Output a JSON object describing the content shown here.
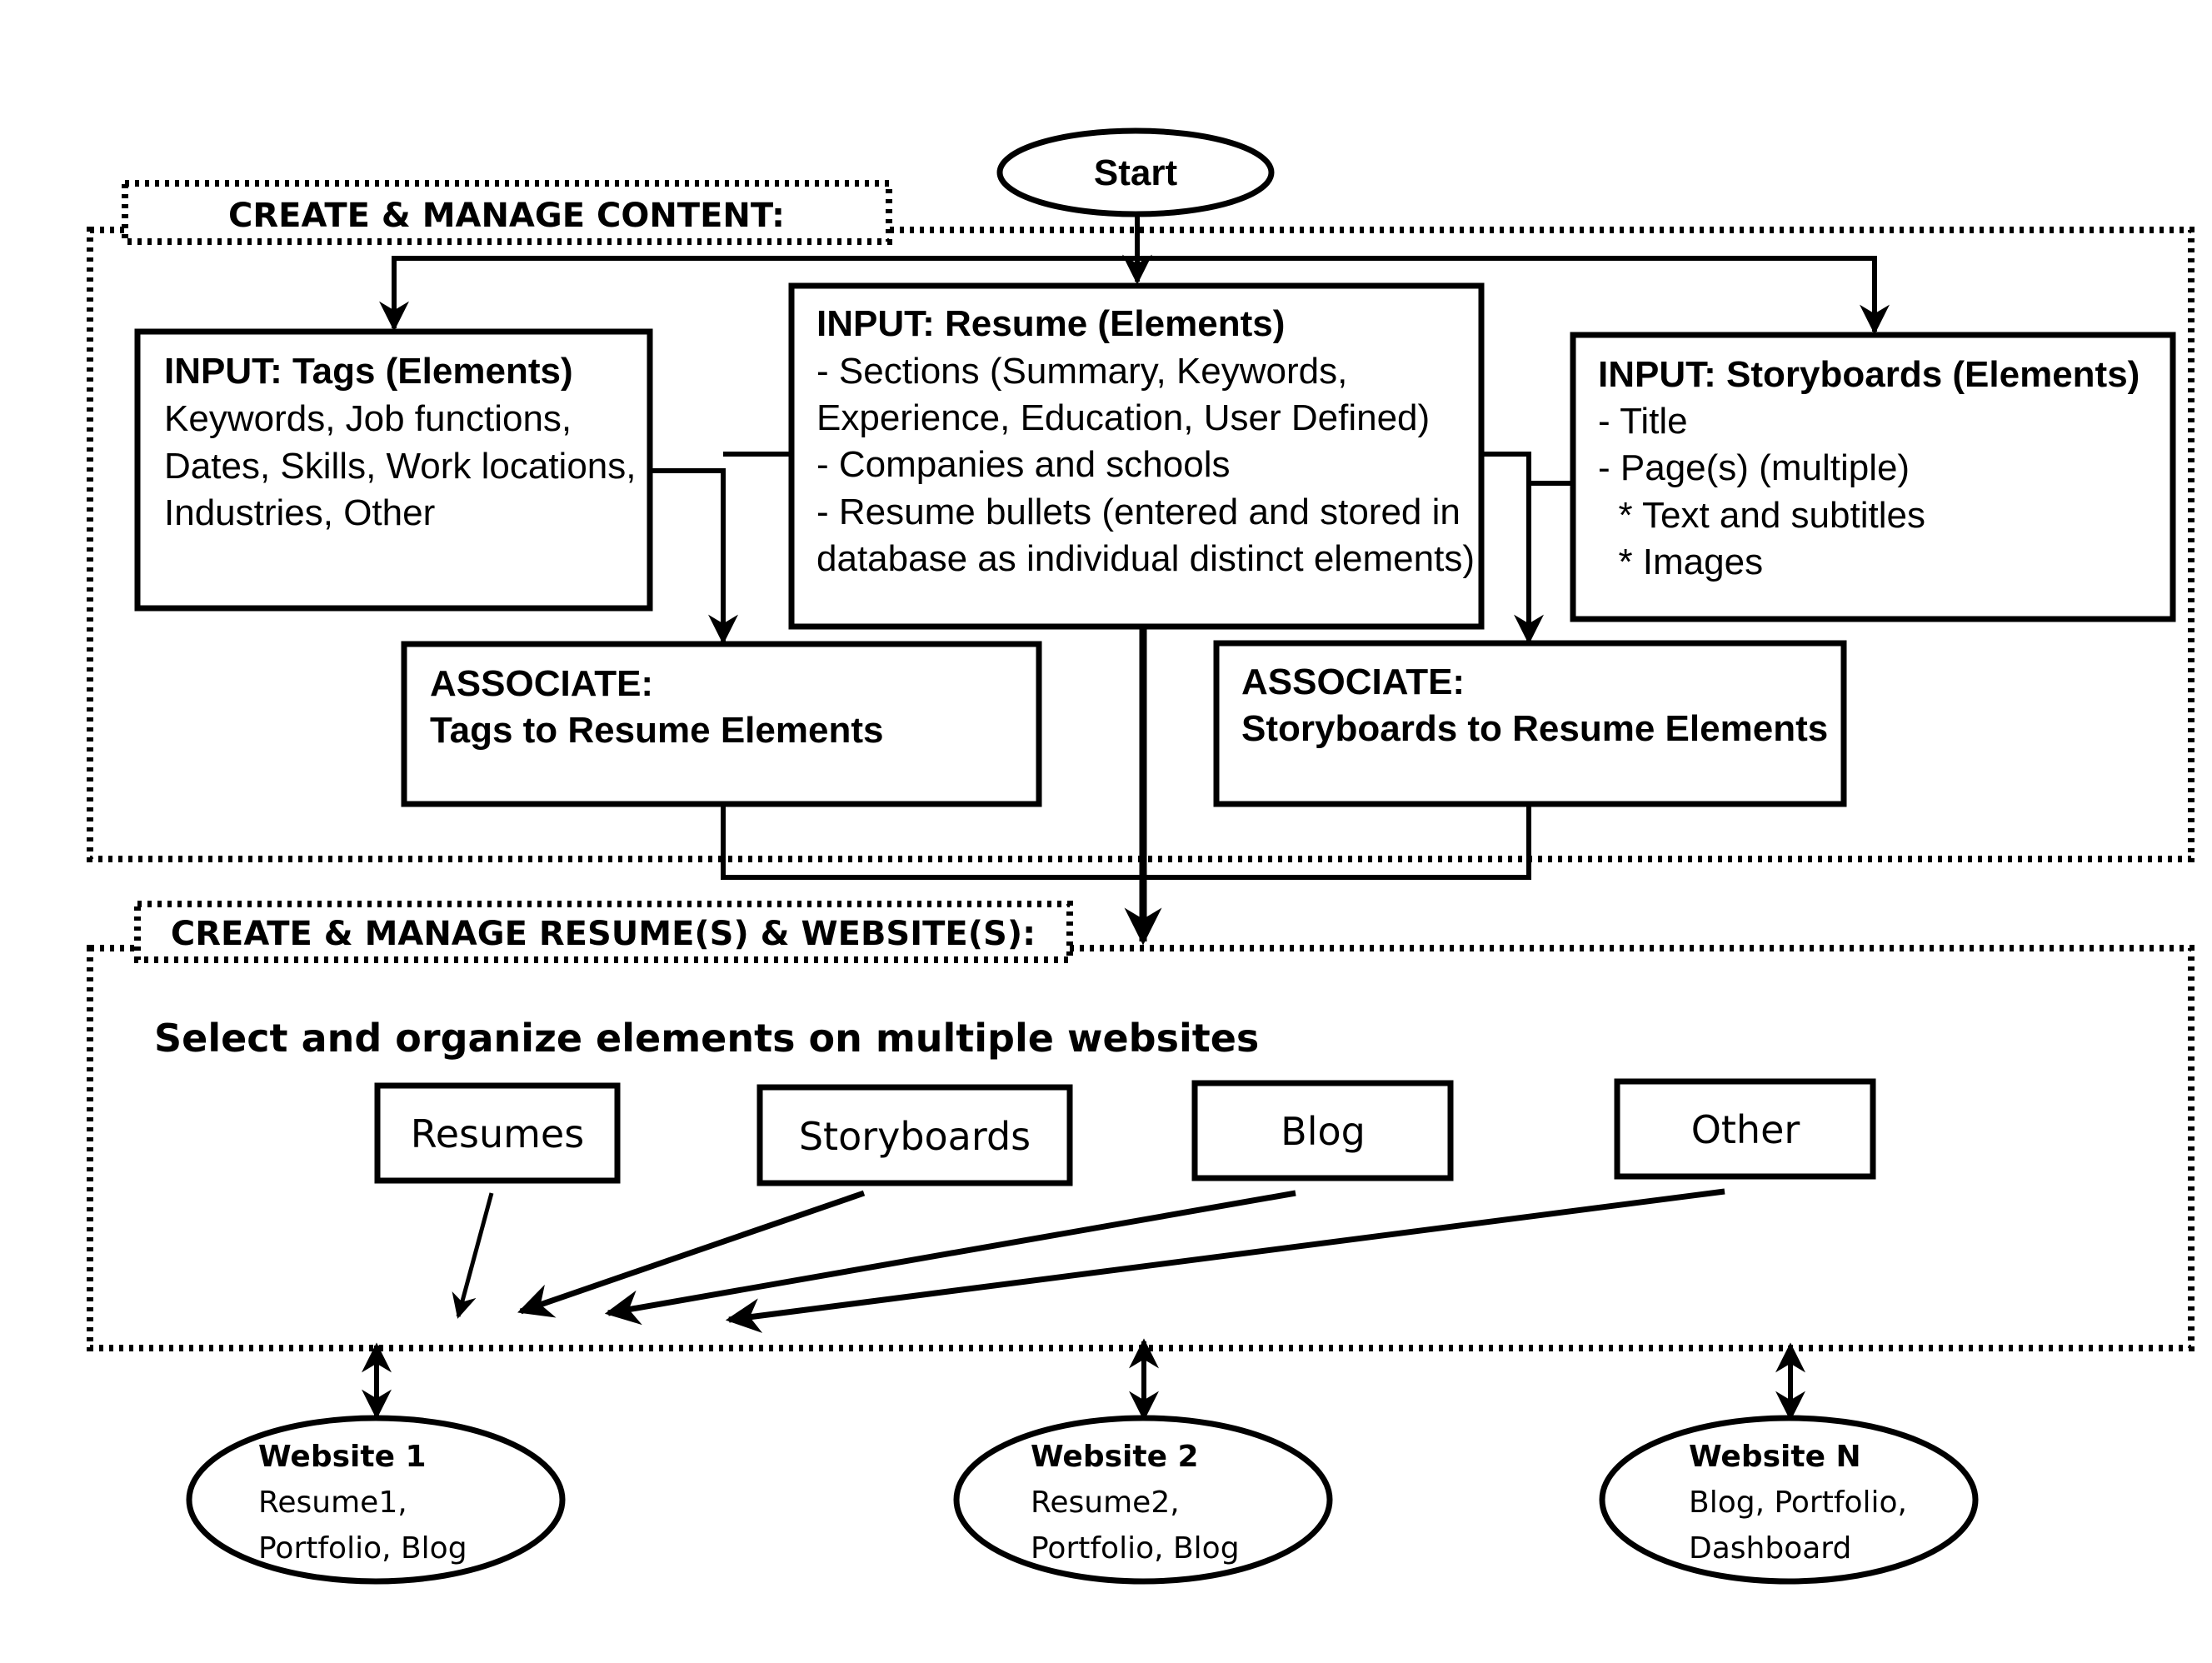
{
  "start": {
    "label": "Start"
  },
  "content_section": {
    "label": "CREATE & MANAGE CONTENT:",
    "tags_box": {
      "title": "INPUT: Tags (Elements)",
      "lines": [
        "Keywords, Job functions,",
        "Dates, Skills, Work locations,",
        "Industries, Other"
      ]
    },
    "resume_box": {
      "title": "INPUT: Resume (Elements)",
      "lines": [
        "- Sections (Summary, Keywords,",
        "Experience, Education, User Defined)",
        "- Companies and schools",
        "- Resume bullets (entered and stored in",
        "database as individual distinct elements)"
      ]
    },
    "storyboards_box": {
      "title": "INPUT: Storyboards (Elements)",
      "lines": [
        "- Title",
        "- Page(s) (multiple)",
        "  * Text and subtitles",
        "  * Images"
      ]
    },
    "associate_tags": {
      "title": "ASSOCIATE:",
      "subtitle": "Tags to Resume Elements"
    },
    "associate_storyboards": {
      "title": "ASSOCIATE:",
      "subtitle": "Storyboards to Resume Elements"
    }
  },
  "websites_section": {
    "label": "CREATE & MANAGE RESUME(S) & WEBSITE(S):",
    "heading": "Select and organize elements on multiple websites",
    "categories": [
      "Resumes",
      "Storyboards",
      "Blog",
      "Other"
    ]
  },
  "websites": [
    {
      "title": "Website 1",
      "lines": [
        "Resume1,",
        "Portfolio, Blog"
      ]
    },
    {
      "title": "Website 2",
      "lines": [
        "Resume2,",
        "Portfolio, Blog"
      ]
    },
    {
      "title": "Website N",
      "lines": [
        "Blog, Portfolio,",
        "Dashboard"
      ]
    }
  ]
}
